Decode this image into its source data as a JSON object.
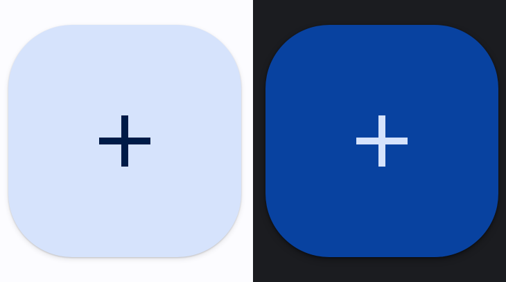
{
  "panels": [
    {
      "theme": "light",
      "background": "#fcfcff",
      "fab": {
        "icon": "add-icon",
        "container_color": "#d6e3fc",
        "icon_color": "#001b47"
      }
    },
    {
      "theme": "dark",
      "background": "#1b1c20",
      "fab": {
        "icon": "add-icon",
        "container_color": "#0842a0",
        "icon_color": "#d6e3fc"
      }
    }
  ]
}
